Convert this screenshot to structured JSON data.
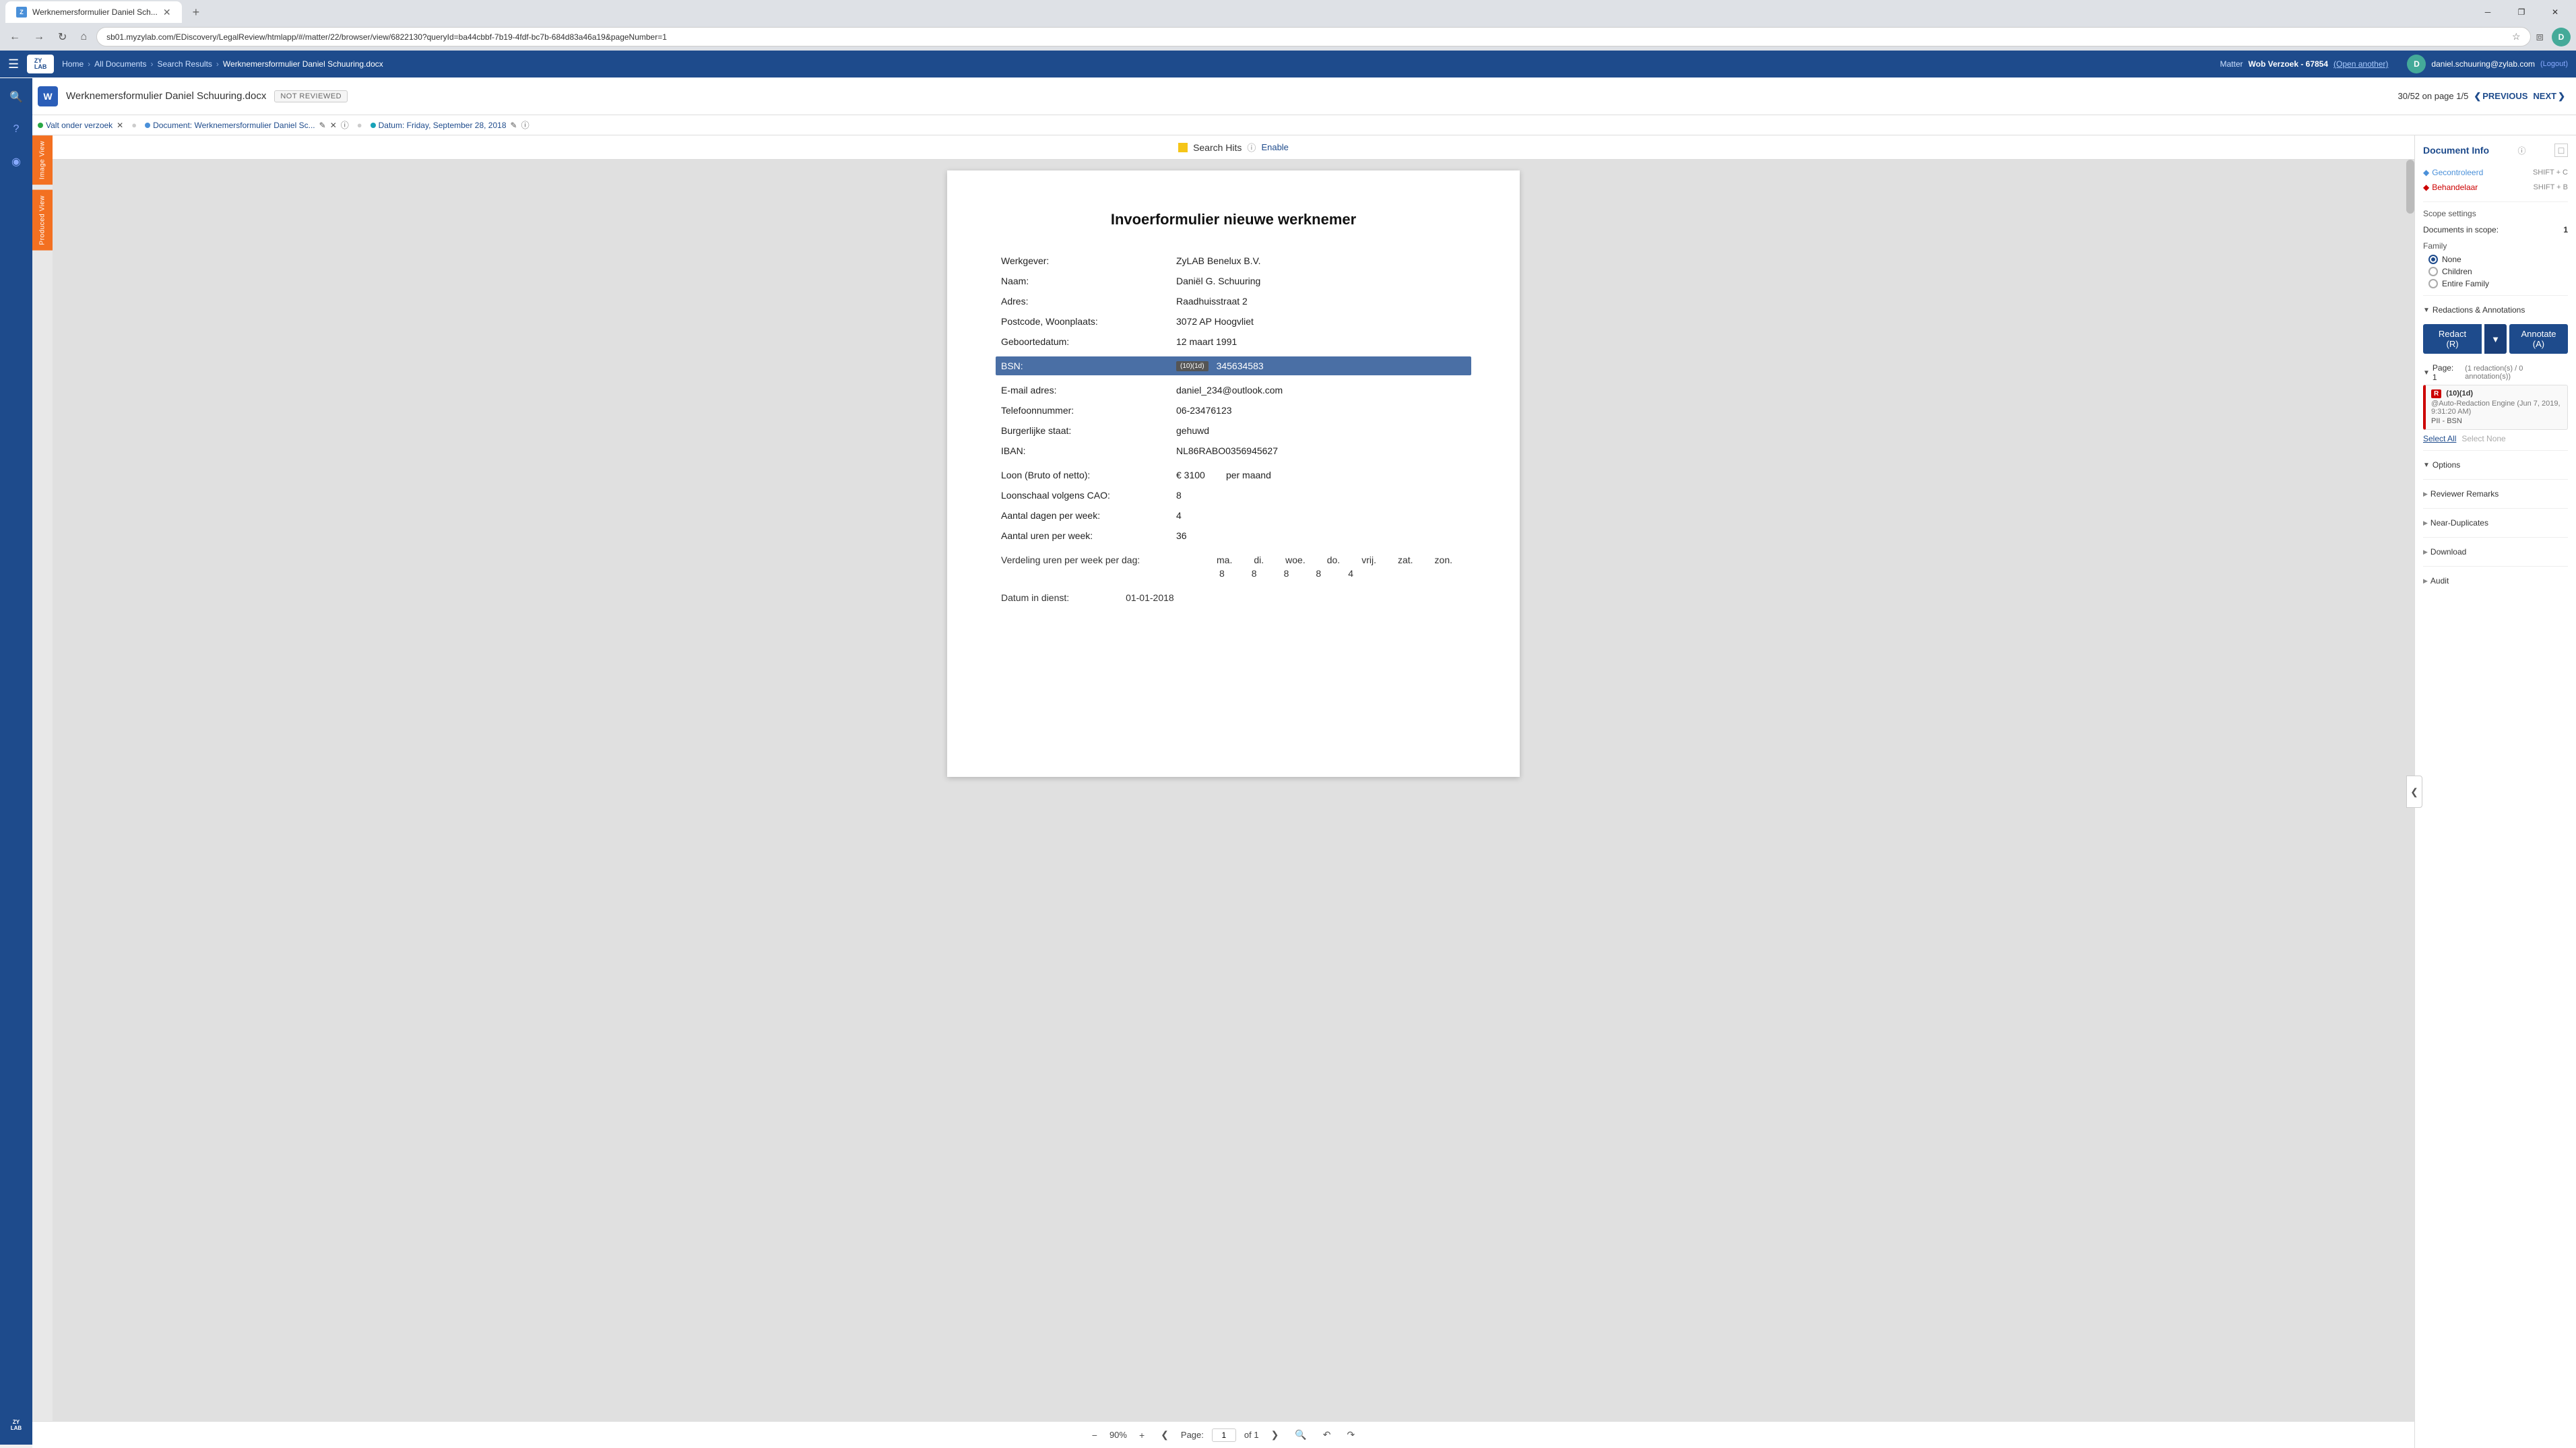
{
  "browser": {
    "tab_label": "Werknemersformulier Daniel Sch...",
    "url": "sb01.myzylab.com/EDiscovery/LegalReview/htmlapp/#/matter/22/browser/view/6822130?queryId=ba44cbbf-7b19-4fdf-bc7b-684d83a46a19&pageNumber=1",
    "win_min": "─",
    "win_max": "❐",
    "win_close": "✕"
  },
  "topbar": {
    "home": "Home",
    "all_docs": "All Documents",
    "search_results": "Search Results",
    "doc_name": "Werknemersformulier Daniel Schuuring.docx",
    "matter_label": "Matter",
    "matter_name": "Wob Verzoek - 67854",
    "open_another": "(Open another)",
    "user_email": "daniel.schuuring@zylab.com",
    "logout": "(Logout)",
    "user_initial": "D"
  },
  "doc_header": {
    "word_icon": "W",
    "title": "Werknemersformulier Daniel Schuuring.docx",
    "status": "NOT REVIEWED",
    "page_info": "30/52 on page 1/5",
    "prev": "PREVIOUS",
    "next": "NEXT"
  },
  "tags": {
    "tag1": "Valt onder verzoek",
    "tag2": "Document: Werknemersformulier Daniel Sc...",
    "tag3": "Datum: Friday, September 28, 2018"
  },
  "viewer": {
    "tab1": "Image View",
    "tab2": "Produced View",
    "search_hits_label": "Search Hits",
    "enable_label": "Enable",
    "page_zoom": "90%",
    "page_number": "1",
    "page_of": "of 1"
  },
  "document": {
    "title": "Invoerformulier nieuwe werknemer",
    "fields": [
      {
        "label": "Werkgever:",
        "value": "ZyLAB Benelux B.V."
      },
      {
        "label": "Naam:",
        "value": "Daniël G. Schuuring"
      },
      {
        "label": "Adres:",
        "value": "Raadhuisstraat 2"
      },
      {
        "label": "Postcode, Woonplaats:",
        "value": "3072 AP Hoogvliet"
      },
      {
        "label": "Geboortedatum:",
        "value": "12 maart 1991"
      },
      {
        "label": "BSN:",
        "value": "345634583",
        "highlighted": true,
        "redaction": "(10)(1d)"
      },
      {
        "label": "E-mail adres:",
        "value": "daniel_234@outlook.com"
      },
      {
        "label": "Telefoonnummer:",
        "value": "06-23476123"
      },
      {
        "label": "Burgerlijke staat:",
        "value": "gehuwd"
      },
      {
        "label": "IBAN:",
        "value": "NL86RABO0356945627"
      }
    ],
    "salary_fields": [
      {
        "label": "Loon (Bruto of netto):",
        "value": "€  3100         per maand"
      },
      {
        "label": "Loonschaal volgens CAO:",
        "value": "8"
      },
      {
        "label": "Aantal dagen per week:",
        "value": "4"
      },
      {
        "label": "Aantal uren per week:",
        "value": "36"
      }
    ],
    "schedule_label": "Verdeling uren per week per dag:",
    "schedule_headers": [
      "ma.",
      "di.",
      "woe.",
      "do.",
      "vrij.",
      "zat.",
      "zon."
    ],
    "schedule_values": [
      "8",
      "8",
      "8",
      "8",
      "4",
      "",
      ""
    ],
    "dienst_label": "Datum in dienst:",
    "dienst_value": "01-01-2018"
  },
  "right_panel": {
    "title": "Document Info",
    "controlled_label": "Gecontroleerd",
    "controlled_shortcut": "SHIFT + C",
    "handler_label": "Behandelaar",
    "handler_shortcut": "SHIFT + B",
    "scope_settings": "Scope settings",
    "docs_in_scope": "Documents in scope:",
    "docs_in_scope_value": "1",
    "family_label": "Family",
    "family_none": "None",
    "family_children": "Children",
    "family_entire": "Entire Family",
    "redactions_label": "Redactions & Annotations",
    "redact_btn": "Redact (R)",
    "annotate_btn": "Annotate (A)",
    "page_label": "Page: 1",
    "page_redactions": "(1 redaction(s) / 0 annotation(s))",
    "redaction_code": "(10)(1d)",
    "redaction_meta": "@Auto-Redaction Engine (Jun 7, 2019, 9:31:20 AM)",
    "redaction_tag": "PII - BSN",
    "select_all": "Select All",
    "select_none": "Select None",
    "options_label": "Options",
    "reviewer_remarks": "Reviewer Remarks",
    "near_duplicates": "Near-Duplicates",
    "download": "Download",
    "audit": "Audit"
  }
}
